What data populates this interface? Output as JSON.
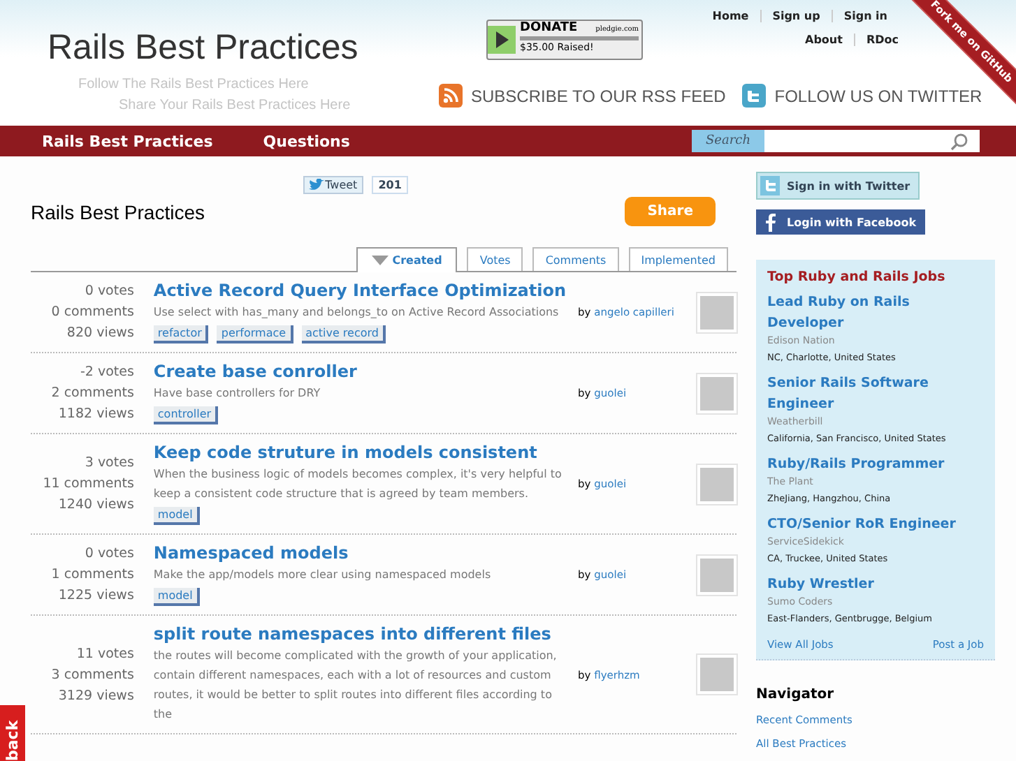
{
  "header": {
    "title": "Rails Best Practices",
    "taglines": [
      "Follow The Rails Best Practices Here",
      "Share Your Rails Best Practices Here"
    ],
    "top_links": [
      [
        "Home",
        "Sign up",
        "Sign in"
      ],
      [
        "About",
        "RDoc"
      ]
    ],
    "donate": {
      "label": "DONATE",
      "site": "pledgie.com",
      "raised": "$35.00 Raised!"
    },
    "rss": "SUBSCRIBE TO OUR RSS FEED",
    "twitter": "FOLLOW US ON TWITTER",
    "ribbon": "Fork me on GitHub"
  },
  "nav": {
    "items": [
      "Rails Best Practices",
      "Questions"
    ],
    "search_label": "Search"
  },
  "tweet": {
    "label": "Tweet",
    "count": "201"
  },
  "page_title": "Rails Best Practices",
  "share": "Share",
  "tabs": [
    {
      "label": "Created",
      "selected": true
    },
    {
      "label": "Votes",
      "selected": false
    },
    {
      "label": "Comments",
      "selected": false
    },
    {
      "label": "Implemented",
      "selected": false
    }
  ],
  "posts": [
    {
      "votes": "0 votes",
      "comments": "0 comments",
      "views": "820 views",
      "title": "Active Record Query Interface Optimization",
      "summary": "Use select with has_many and belongs_to on Active Record Associations",
      "tags": [
        "refactor",
        "performace",
        "active record"
      ],
      "by": "by",
      "author": "angelo capilleri"
    },
    {
      "votes": "-2 votes",
      "comments": "2 comments",
      "views": "1182 views",
      "title": "Create base conroller",
      "summary": "Have base controllers for DRY",
      "tags": [
        "controller"
      ],
      "by": "by",
      "author": "guolei"
    },
    {
      "votes": "3 votes",
      "comments": "11 comments",
      "views": "1240 views",
      "title": "Keep code struture in models consistent",
      "summary": "When the business logic of models becomes complex, it's very helpful to keep a consistent code structure that is agreed by team members.",
      "tags": [
        "model"
      ],
      "by": "by",
      "author": "guolei"
    },
    {
      "votes": "0 votes",
      "comments": "1 comments",
      "views": "1225 views",
      "title": "Namespaced models",
      "summary": "Make the app/models more clear using namespaced models",
      "tags": [
        "model"
      ],
      "by": "by",
      "author": "guolei"
    },
    {
      "votes": "11 votes",
      "comments": "3 comments",
      "views": "3129 views",
      "title": "split route namespaces into different files",
      "summary": "the routes will become complicated with the growth of your application, contain different namespaces, each with a lot of resources and custom routes, it would be better to split routes into different files according to the",
      "by": "by",
      "author": "flyerhzm"
    }
  ],
  "sidebar": {
    "twitter_login": "Sign in with Twitter",
    "facebook_login": "Login with Facebook",
    "jobs": {
      "heading": "Top Ruby and Rails Jobs",
      "items": [
        {
          "title": "Lead Ruby on Rails Developer",
          "company": "Edison Nation",
          "location": "NC, Charlotte, United States"
        },
        {
          "title": "Senior Rails Software Engineer",
          "company": "Weatherbill",
          "location": "California, San Francisco, United States"
        },
        {
          "title": "Ruby/Rails Programmer",
          "company": "The Plant",
          "location": "ZheJiang, Hangzhou, China"
        },
        {
          "title": "CTO/Senior RoR Engineer",
          "company": "ServiceSidekick",
          "location": "CA, Truckee, United States"
        },
        {
          "title": "Ruby Wrestler",
          "company": "Sumo Coders",
          "location": "East-Flanders, Gentbrugge, Belgium"
        }
      ],
      "view_all": "View All Jobs",
      "post": "Post a Job"
    },
    "navigator": {
      "heading": "Navigator",
      "links": [
        "Recent Comments",
        "All Best Practices"
      ]
    }
  },
  "feedback": "back"
}
